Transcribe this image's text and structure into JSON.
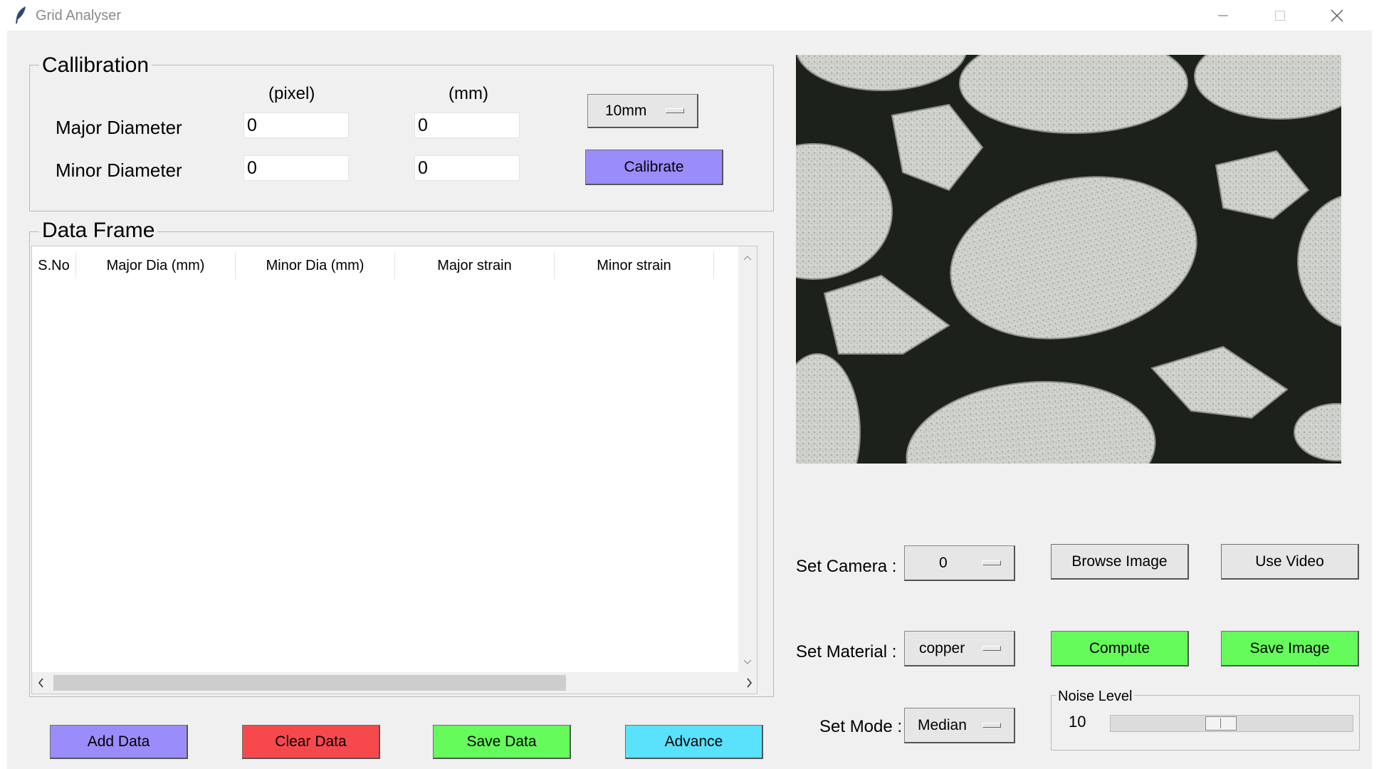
{
  "window": {
    "title": "Grid Analyser",
    "controls": [
      "minimize",
      "maximize",
      "close"
    ]
  },
  "calibration": {
    "title": "Callibration",
    "col_pixel": "(pixel)",
    "col_mm": "(mm)",
    "major_label": "Major Diameter",
    "minor_label": "Minor Diameter",
    "major_pixel": "0",
    "major_mm": "0",
    "minor_pixel": "0",
    "minor_mm": "0",
    "size_option": "10mm",
    "calibrate_label": "Calibrate"
  },
  "data_frame": {
    "title": "Data Frame",
    "columns": [
      "S.No",
      "Major Dia (mm)",
      "Minor Dia (mm)",
      "Major strain",
      "Minor strain"
    ],
    "rows": []
  },
  "buttons": {
    "add_data": "Add Data",
    "clear_data": "Clear Data",
    "save_data": "Save Data",
    "advance": "Advance",
    "browse_image": "Browse Image",
    "use_video": "Use Video",
    "compute": "Compute",
    "save_image": "Save Image"
  },
  "settings": {
    "camera_label": "Set Camera :",
    "camera_value": "0",
    "material_label": "Set Material :",
    "material_value": "copper",
    "mode_label": "Set Mode :",
    "mode_value": "Median"
  },
  "noise": {
    "label": "Noise Level",
    "value": "10",
    "slider_fraction": 0.45
  },
  "colors": {
    "purple": "#9b8cfb",
    "red": "#f7494c",
    "green": "#64fb5b",
    "cyan": "#5ae1fb",
    "window_bg": "#f0f0f0"
  }
}
